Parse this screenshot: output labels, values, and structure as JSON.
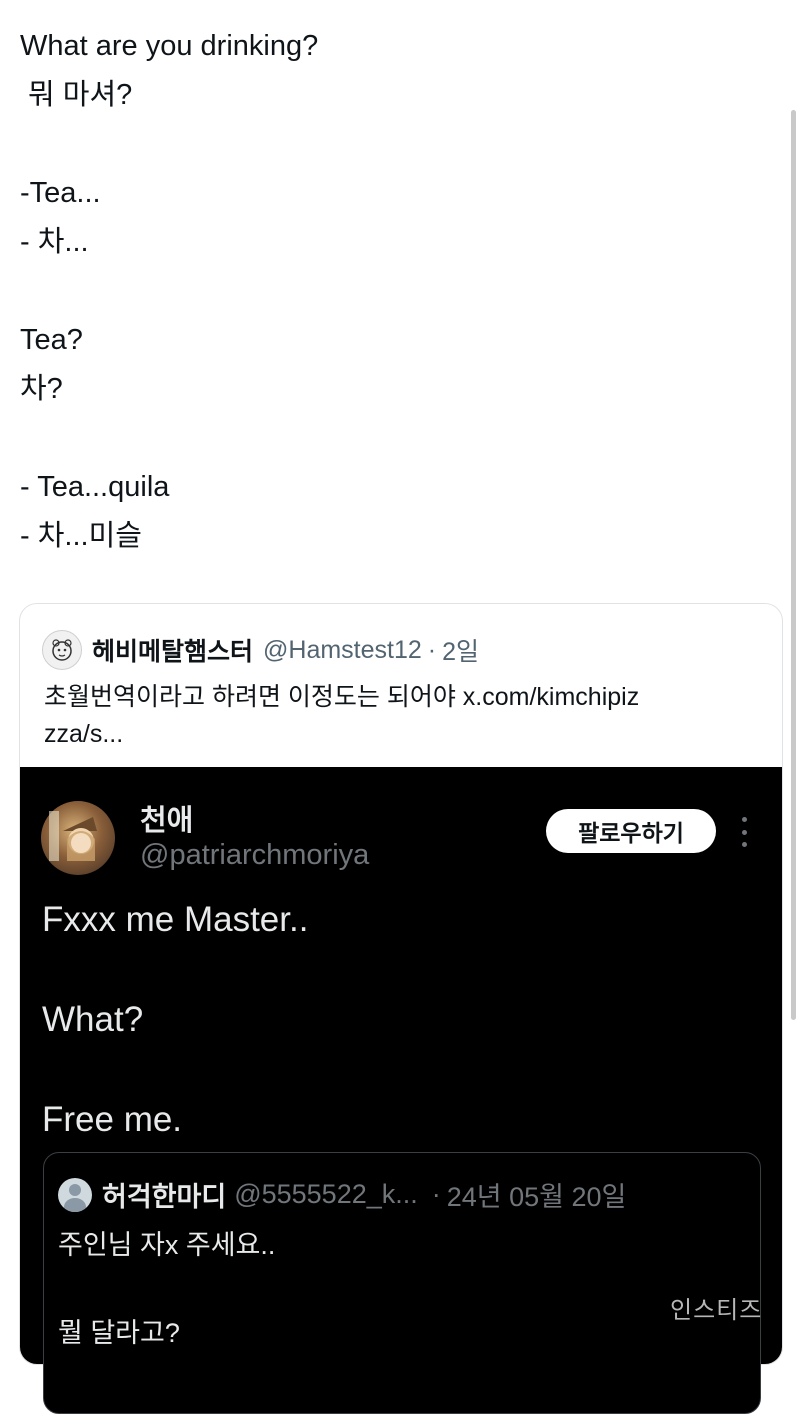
{
  "post": {
    "lines": [
      "What are you drinking?",
      " 뭐 마셔?",
      "",
      "-Tea...",
      "- 차...",
      "",
      "Tea?",
      "차?",
      "",
      "- Tea...quila",
      "- 차...미슬"
    ]
  },
  "quoted_tweet": {
    "author_name": "헤비메탈햄스터",
    "handle": "@Hamstest12",
    "separator": "·",
    "time": "2일",
    "text": "초월번역이라고 하려면 이정도는 되어야 x.com/kimchipizzza/s..."
  },
  "embedded_screenshot": {
    "author_name": "천애",
    "handle": "@patriarchmoriya",
    "follow_label": "팔로우하기",
    "lines": [
      "Fxxx me Master..",
      "",
      "What?",
      "",
      "Free me."
    ],
    "inner_quote": {
      "author_name": "허걱한마디",
      "handle": "@5555522_k...",
      "separator": "·",
      "date": "24년 05월 20일",
      "lines": [
        "주인님 자x 주세요..",
        "",
        "뭘 달라고?"
      ]
    }
  },
  "watermark": "인스티즈",
  "icons": {
    "quoted_avatar": "hamster-sketch-avatar",
    "dark_avatar": "anime-girl-avatar",
    "inner_avatar": "default-user-avatar",
    "more": "more-vertical-icon"
  },
  "colors": {
    "text_primary": "#0f1419",
    "text_secondary": "#536471",
    "dark_bg": "#000000",
    "dark_text": "#e7e9ea",
    "dark_secondary": "#71767b"
  }
}
